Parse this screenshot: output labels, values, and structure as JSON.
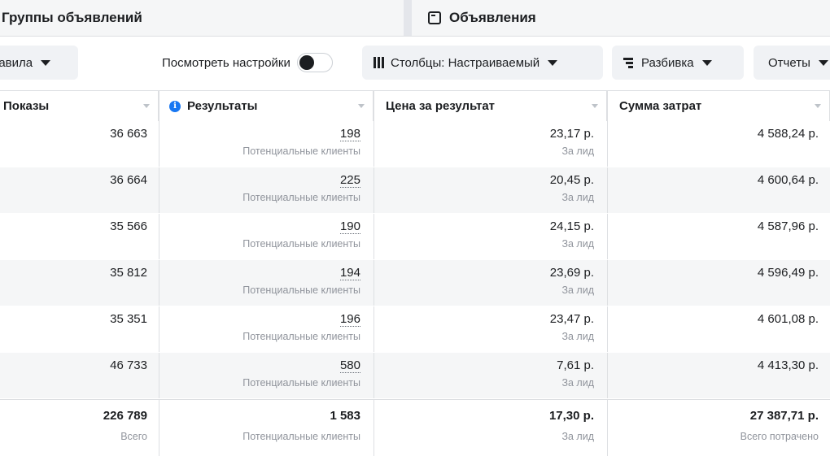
{
  "tabs": {
    "ad_sets": "Группы объявлений",
    "ads": "Объявления"
  },
  "toolbar": {
    "rules": "равила",
    "view_settings": "Посмотреть настройки",
    "columns": "Столбцы: Настраиваемый",
    "breakdown": "Разбивка",
    "reports": "Отчеты"
  },
  "table": {
    "headers": {
      "impressions": "Показы",
      "results": "Результаты",
      "cost_per_result": "Цена за результат",
      "amount_spent": "Сумма затрат"
    },
    "rows": [
      {
        "impressions": "36 663",
        "results": "198",
        "results_sub": "Потенциальные клиенты",
        "cost": "23,17 р.",
        "cost_sub": "За лид",
        "spent": "4 588,24 р."
      },
      {
        "impressions": "36 664",
        "results": "225",
        "results_sub": "Потенциальные клиенты",
        "cost": "20,45 р.",
        "cost_sub": "За лид",
        "spent": "4 600,64 р."
      },
      {
        "impressions": "35 566",
        "results": "190",
        "results_sub": "Потенциальные клиенты",
        "cost": "24,15 р.",
        "cost_sub": "За лид",
        "spent": "4 587,96 р."
      },
      {
        "impressions": "35 812",
        "results": "194",
        "results_sub": "Потенциальные клиенты",
        "cost": "23,69 р.",
        "cost_sub": "За лид",
        "spent": "4 596,49 р."
      },
      {
        "impressions": "35 351",
        "results": "196",
        "results_sub": "Потенциальные клиенты",
        "cost": "23,47 р.",
        "cost_sub": "За лид",
        "spent": "4 601,08 р."
      },
      {
        "impressions": "46 733",
        "results": "580",
        "results_sub": "Потенциальные клиенты",
        "cost": "7,61 р.",
        "cost_sub": "За лид",
        "spent": "4 413,30 р."
      }
    ],
    "totals": {
      "impressions": "226 789",
      "impressions_sub": "Всего",
      "results": "1 583",
      "results_sub": "Потенциальные клиенты",
      "cost": "17,30 р.",
      "cost_sub": "За лид",
      "spent": "27 387,71 р.",
      "spent_sub": "Всего потрачено"
    }
  }
}
